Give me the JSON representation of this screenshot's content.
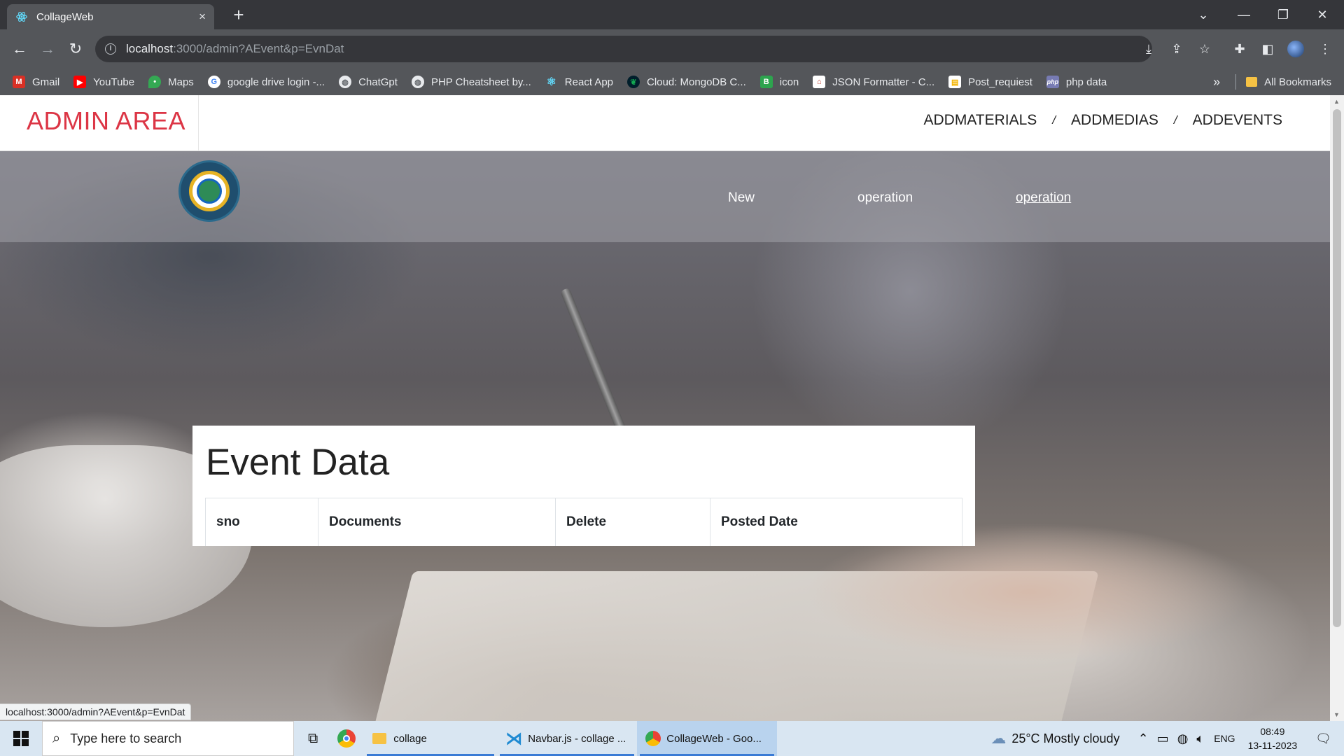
{
  "browser": {
    "tab_title": "CollageWeb",
    "tab_close": "×",
    "new_tab": "+",
    "url_host": "localhost",
    "url_path": ":3000/admin?AEvent&p=EvnDat",
    "bookmarks": [
      {
        "label": "Gmail",
        "icon": "gmail-icon",
        "color": "#d93025"
      },
      {
        "label": "YouTube",
        "icon": "youtube-icon",
        "color": "#ff0000"
      },
      {
        "label": "Maps",
        "icon": "maps-icon",
        "color": "#34a853"
      },
      {
        "label": "google drive login -...",
        "icon": "google-icon",
        "color": "#4285f4"
      },
      {
        "label": "ChatGpt",
        "icon": "globe-icon",
        "color": "#5f6368"
      },
      {
        "label": "PHP Cheatsheet by...",
        "icon": "globe-icon",
        "color": "#5f6368"
      },
      {
        "label": "React App",
        "icon": "react-icon",
        "color": "#61dafb"
      },
      {
        "label": "Cloud: MongoDB C...",
        "icon": "mongodb-icon",
        "color": "#13aa52"
      },
      {
        "label": "icon",
        "icon": "app-icon",
        "color": "#2da44e"
      },
      {
        "label": "JSON Formatter - C...",
        "icon": "json-icon",
        "color": "#c0392b"
      },
      {
        "label": "Post_requiest",
        "icon": "page-icon",
        "color": "#f4b400"
      },
      {
        "label": "php data",
        "icon": "php-icon",
        "color": "#777bb3"
      }
    ],
    "more_bookmarks": "»",
    "all_bookmarks": "All Bookmarks",
    "status_url": "localhost:3000/admin?AEvent&p=EvnDat"
  },
  "admin": {
    "brand": "ADMIN AREA",
    "nav": [
      "ADDMATERIALS",
      "ADDMEDIAS",
      "ADDEVENTS"
    ],
    "separator": "/"
  },
  "subnav": [
    "New",
    "operation",
    "operation"
  ],
  "card": {
    "title": "Event Data",
    "columns": [
      "sno",
      "Documents",
      "Delete",
      "Posted Date"
    ]
  },
  "taskbar": {
    "search_placeholder": "Type here to search",
    "items": [
      "collage",
      "Navbar.js - collage ...",
      "CollageWeb - Goo..."
    ],
    "weather": "25°C  Mostly cloudy",
    "lang": "ENG",
    "time": "08:49",
    "date": "13-11-2023"
  },
  "colors": {
    "brand_red": "#dc3545",
    "accent_blue": "#3a7bd5"
  }
}
